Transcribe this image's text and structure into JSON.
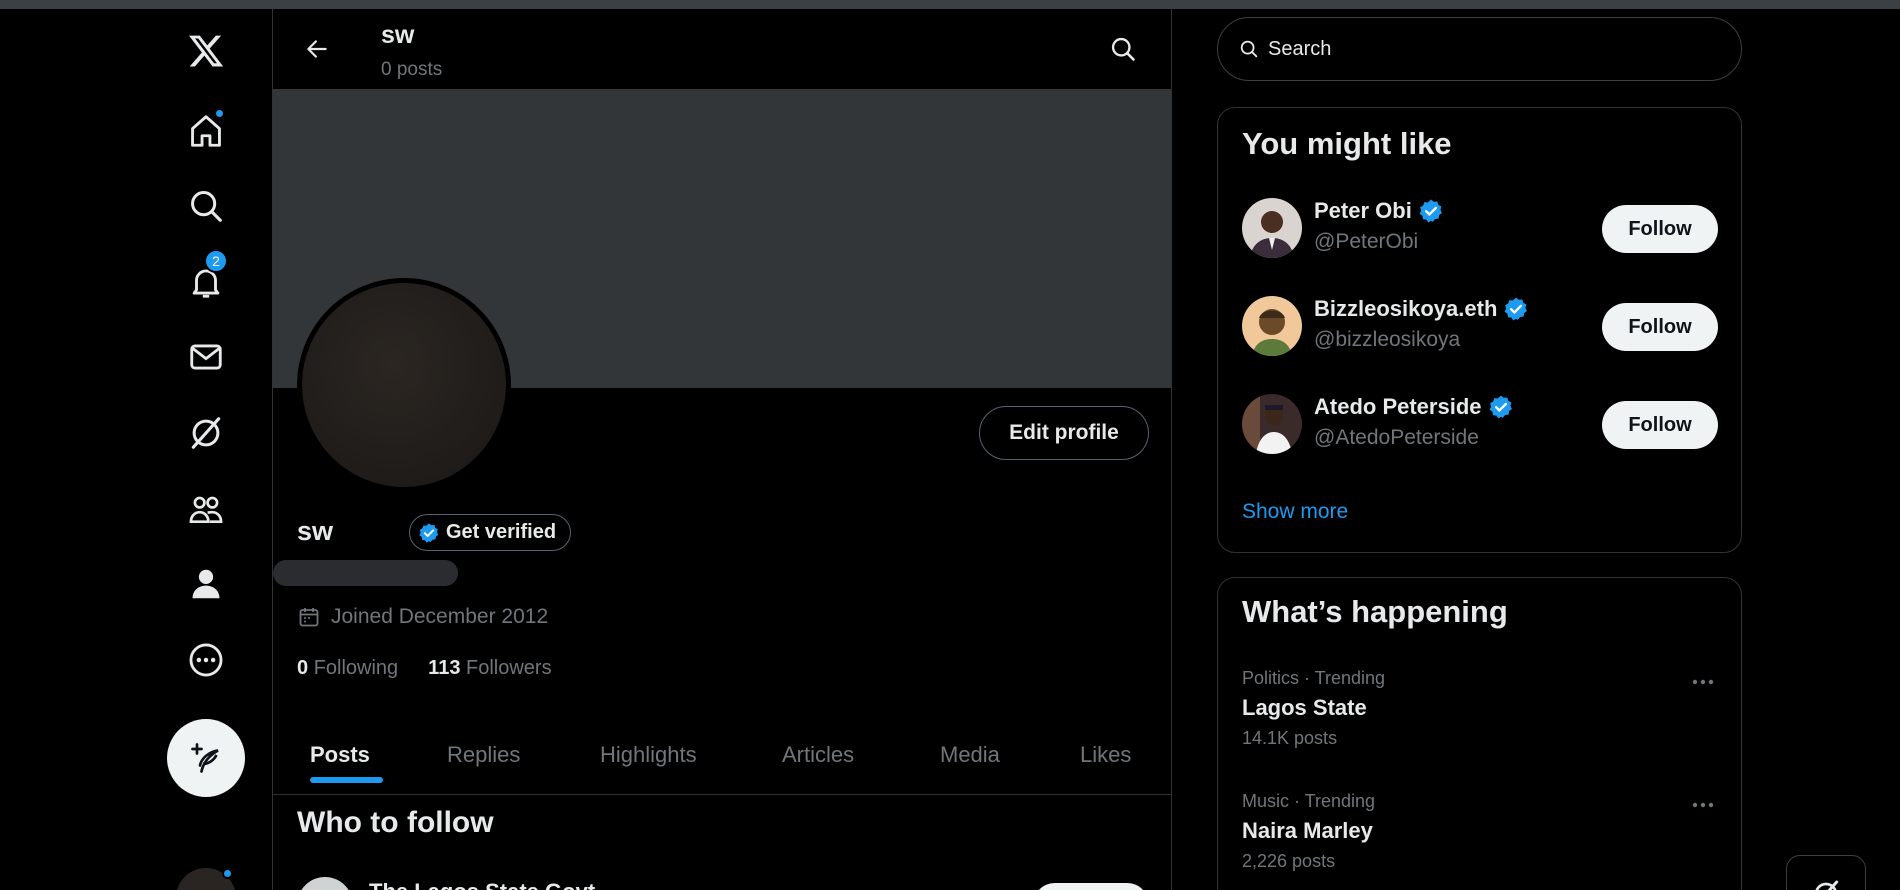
{
  "nav": {
    "notifications_count": "2",
    "accent_color": "#1d9bf0",
    "icons": [
      "x-logo-icon",
      "home-icon",
      "search-icon",
      "bell-icon",
      "mail-icon",
      "grok-icon",
      "communities-icon",
      "profile-icon",
      "more-circle-icon",
      "compose-feather-icon"
    ]
  },
  "header": {
    "name": "sw",
    "posts_count": "0 posts"
  },
  "profile": {
    "display_name": "sw",
    "get_verified_label": "Get verified",
    "edit_profile_label": "Edit profile",
    "joined": "Joined December 2012",
    "following_count": "0",
    "following_label": "Following",
    "followers_count": "113",
    "followers_label": "Followers"
  },
  "tabs": [
    "Posts",
    "Replies",
    "Highlights",
    "Articles",
    "Media",
    "Likes"
  ],
  "who_to_follow": {
    "title": "Who to follow",
    "first_name": "The Lagos State Govt"
  },
  "search": {
    "placeholder": "Search"
  },
  "you_might_like": {
    "title": "You might like",
    "items": [
      {
        "name": "Peter Obi",
        "handle": "@PeterObi",
        "button": "Follow"
      },
      {
        "name": "Bizzleosikoya.eth",
        "handle": "@bizzleosikoya",
        "button": "Follow"
      },
      {
        "name": "Atedo Peterside",
        "handle": "@AtedoPeterside",
        "button": "Follow"
      }
    ],
    "show_more": "Show more"
  },
  "whats_happening": {
    "title": "What’s happening",
    "trends": [
      {
        "meta": "Politics · Trending",
        "name": "Lagos State",
        "count": "14.1K posts"
      },
      {
        "meta": "Music · Trending",
        "name": "Naira Marley",
        "count": "2,226 posts"
      }
    ]
  }
}
